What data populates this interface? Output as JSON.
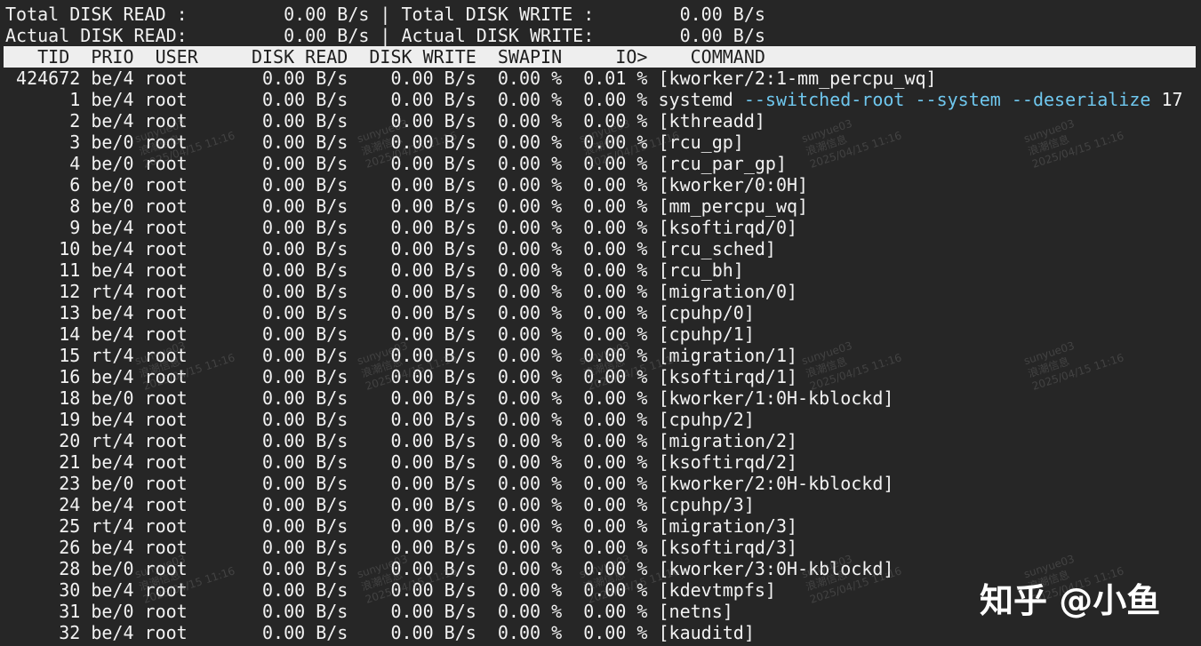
{
  "summary": {
    "total_read": "Total DISK READ :         0.00 B/s | Total DISK WRITE :        0.00 B/s",
    "actual_read": "Actual DISK READ:         0.00 B/s | Actual DISK WRITE:        0.00 B/s"
  },
  "header": "   TID  PRIO  USER     DISK READ  DISK WRITE  SWAPIN     IO>    COMMAND",
  "rows": [
    {
      "text": " 424672 be/4 root       0.00 B/s    0.00 B/s  0.00 %  0.01 % [kworker/2:1-mm_percpu_wq]"
    },
    {
      "text": "      1 be/4 root       0.00 B/s    0.00 B/s  0.00 %  0.00 % ",
      "cmd": "systemd",
      "flags": " --switched-root --system --deserialize",
      "tail": " 17"
    },
    {
      "text": "      2 be/4 root       0.00 B/s    0.00 B/s  0.00 %  0.00 % [kthreadd]"
    },
    {
      "text": "      3 be/0 root       0.00 B/s    0.00 B/s  0.00 %  0.00 % [rcu_gp]"
    },
    {
      "text": "      4 be/0 root       0.00 B/s    0.00 B/s  0.00 %  0.00 % [rcu_par_gp]"
    },
    {
      "text": "      6 be/0 root       0.00 B/s    0.00 B/s  0.00 %  0.00 % [kworker/0:0H]"
    },
    {
      "text": "      8 be/0 root       0.00 B/s    0.00 B/s  0.00 %  0.00 % [mm_percpu_wq]"
    },
    {
      "text": "      9 be/4 root       0.00 B/s    0.00 B/s  0.00 %  0.00 % [ksoftirqd/0]"
    },
    {
      "text": "     10 be/4 root       0.00 B/s    0.00 B/s  0.00 %  0.00 % [rcu_sched]"
    },
    {
      "text": "     11 be/4 root       0.00 B/s    0.00 B/s  0.00 %  0.00 % [rcu_bh]"
    },
    {
      "text": "     12 rt/4 root       0.00 B/s    0.00 B/s  0.00 %  0.00 % [migration/0]"
    },
    {
      "text": "     13 be/4 root       0.00 B/s    0.00 B/s  0.00 %  0.00 % [cpuhp/0]"
    },
    {
      "text": "     14 be/4 root       0.00 B/s    0.00 B/s  0.00 %  0.00 % [cpuhp/1]"
    },
    {
      "text": "     15 rt/4 root       0.00 B/s    0.00 B/s  0.00 %  0.00 % [migration/1]"
    },
    {
      "text": "     16 be/4 root       0.00 B/s    0.00 B/s  0.00 %  0.00 % [ksoftirqd/1]"
    },
    {
      "text": "     18 be/0 root       0.00 B/s    0.00 B/s  0.00 %  0.00 % [kworker/1:0H-kblockd]"
    },
    {
      "text": "     19 be/4 root       0.00 B/s    0.00 B/s  0.00 %  0.00 % [cpuhp/2]"
    },
    {
      "text": "     20 rt/4 root       0.00 B/s    0.00 B/s  0.00 %  0.00 % [migration/2]"
    },
    {
      "text": "     21 be/4 root       0.00 B/s    0.00 B/s  0.00 %  0.00 % [ksoftirqd/2]"
    },
    {
      "text": "     23 be/0 root       0.00 B/s    0.00 B/s  0.00 %  0.00 % [kworker/2:0H-kblockd]"
    },
    {
      "text": "     24 be/4 root       0.00 B/s    0.00 B/s  0.00 %  0.00 % [cpuhp/3]"
    },
    {
      "text": "     25 rt/4 root       0.00 B/s    0.00 B/s  0.00 %  0.00 % [migration/3]"
    },
    {
      "text": "     26 be/4 root       0.00 B/s    0.00 B/s  0.00 %  0.00 % [ksoftirqd/3]"
    },
    {
      "text": "     28 be/0 root       0.00 B/s    0.00 B/s  0.00 %  0.00 % [kworker/3:0H-kblockd]"
    },
    {
      "text": "     30 be/4 root       0.00 B/s    0.00 B/s  0.00 %  0.00 % [kdevtmpfs]"
    },
    {
      "text": "     31 be/0 root       0.00 B/s    0.00 B/s  0.00 %  0.00 % [netns]"
    },
    {
      "text": "     32 be/4 root       0.00 B/s    0.00 B/s  0.00 %  0.00 % [kauditd]"
    }
  ],
  "watermark": {
    "user": "sunyue03",
    "org": "浪潮信息",
    "date": "2025/04/15 11:16"
  },
  "brand": "知乎 @小鱼",
  "colors": {
    "background": "#262626",
    "text": "#f2f2f2",
    "header_bg": "#eeeeee",
    "flag_text": "#6fc7ee"
  }
}
